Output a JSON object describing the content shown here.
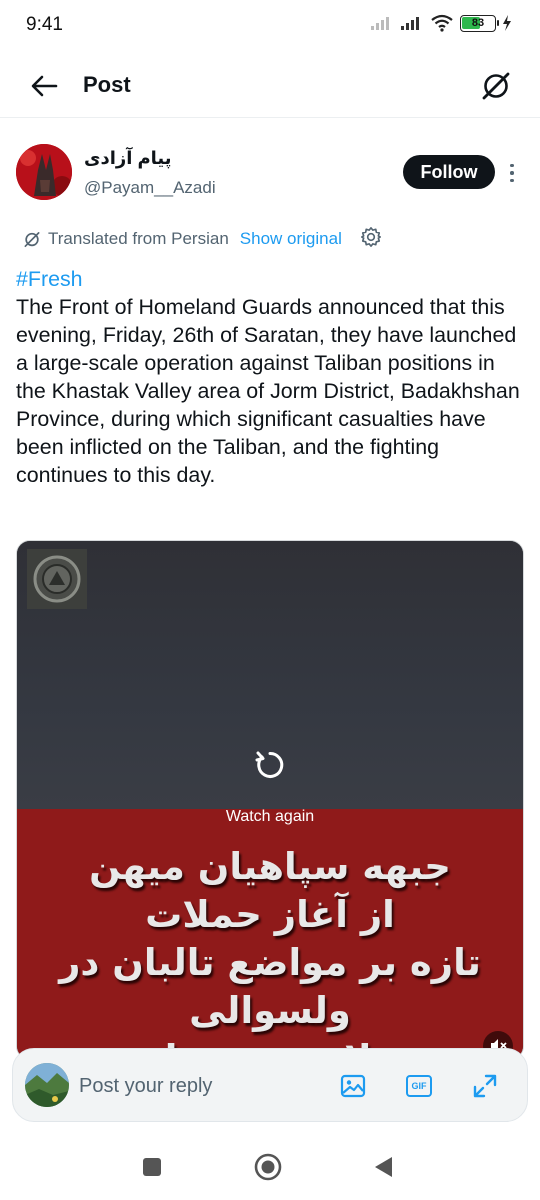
{
  "status_bar": {
    "time": "9:41",
    "battery_level": "83",
    "icons": [
      "signal-icon",
      "signal-icon",
      "wifi-icon",
      "battery-icon",
      "charging-icon"
    ]
  },
  "header": {
    "back_icon": "arrow-left-icon",
    "title": "Post",
    "grok_icon": "grok-icon"
  },
  "author": {
    "display_name": "پیام آزادی",
    "handle": "@Payam__Azadi",
    "follow_label": "Follow",
    "more_icon": "more-vertical-icon"
  },
  "translation": {
    "label": "Translated from Persian",
    "show_original": "Show original",
    "settings_icon": "gear-icon"
  },
  "post": {
    "hashtag": "#Fresh",
    "text": "The Front of Homeland Guards announced that this evening, Friday, 26th of Saratan, they have launched a large-scale operation against Taliban positions in the Khastak Valley area of Jorm District, Badakhshan Province, during which significant casualties have been inflicted on the Taliban, and the fighting continues to this day."
  },
  "media": {
    "watch_again": "Watch again",
    "overlay_lines": [
      "جبهه سپاهیان میهن",
      "از آغاز حملات",
      "تازه بر مواضع تالبان در ولسوالی",
      "جرم ولایت بدخشان خبر داد."
    ],
    "replay_icon": "replay-icon",
    "mute_icon": "mute-icon",
    "colors": {
      "top": "#343841",
      "bottom": "#8f1a1a"
    }
  },
  "reply": {
    "placeholder": "Post your reply",
    "icons": [
      "image-icon",
      "gif-icon",
      "expand-icon"
    ],
    "gif_label": "GIF"
  },
  "nav": {
    "icons": [
      "recents-square-icon",
      "home-circle-icon",
      "back-triangle-icon"
    ]
  },
  "colors": {
    "accent": "#1d9bf0",
    "text": "#0f1419",
    "secondary": "#536471"
  }
}
